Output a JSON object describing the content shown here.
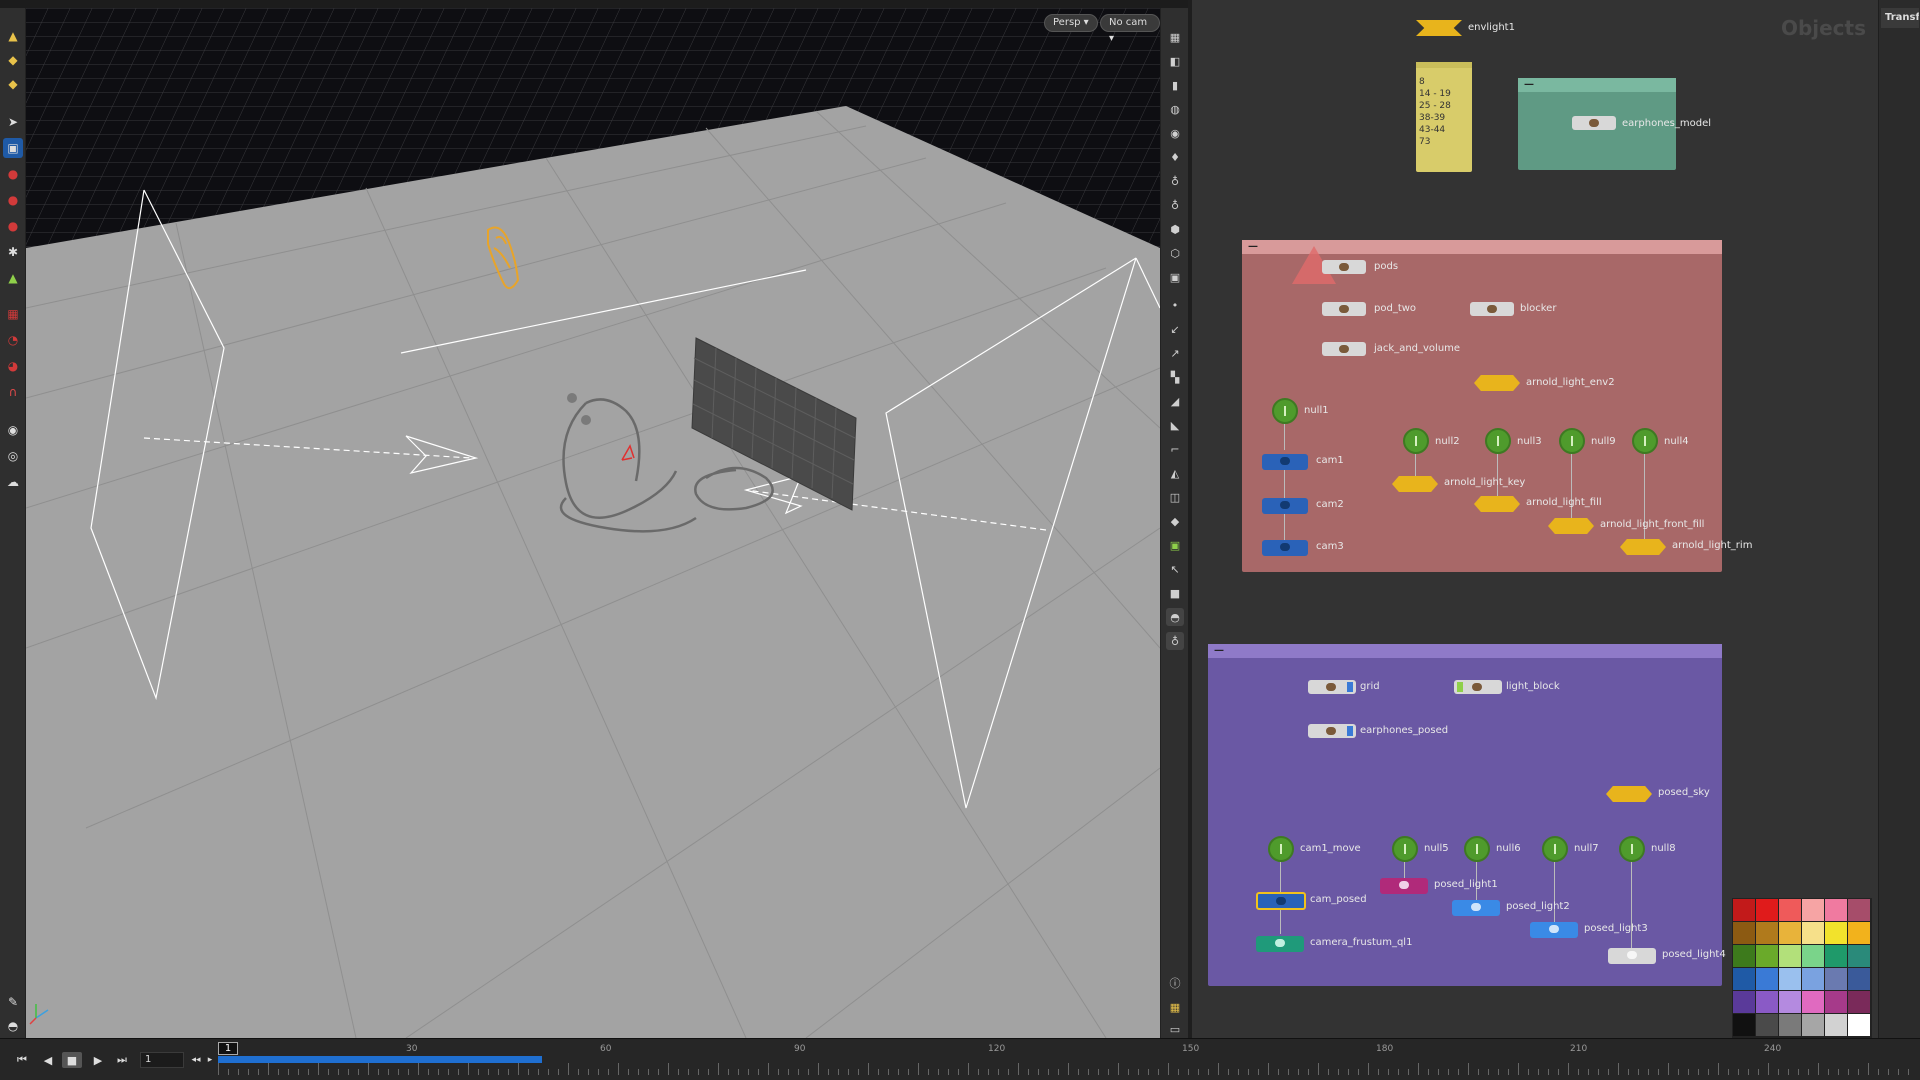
{
  "viewport": {
    "view_menu": "Persp ▾",
    "camera_menu": "No cam ▾"
  },
  "network": {
    "title": "Objects",
    "top_nodes": {
      "envlight": "envlight1",
      "sticky_note_lines": [
        "8",
        "14 - 19",
        "25 - 28",
        "38-39",
        "43-44",
        "73"
      ],
      "earphones_model": "earphones_model"
    },
    "red_box": {
      "pods": "pods",
      "pod_two": "pod_two",
      "blocker": "blocker",
      "jack_and_volume": "jack_and_volume",
      "arnold_light_env2": "arnold_light_env2",
      "null1": "null1",
      "null2": "null2",
      "null3": "null3",
      "null9": "null9",
      "null4": "null4",
      "cam1": "cam1",
      "cam2": "cam2",
      "cam3": "cam3",
      "arnold_light_key": "arnold_light_key",
      "arnold_light_fill": "arnold_light_fill",
      "arnold_light_front_fill": "arnold_light_front_fill",
      "arnold_light_rim": "arnold_light_rim"
    },
    "purple_box": {
      "grid": "grid",
      "light_block": "light_block",
      "earphones_posed": "earphones_posed",
      "posed_sky": "posed_sky",
      "cam1_move": "cam1_move",
      "null5": "null5",
      "null6": "null6",
      "null7": "null7",
      "null8": "null8",
      "posed_light1": "posed_light1",
      "cam_posed": "cam_posed",
      "posed_light2": "posed_light2",
      "posed_light3": "posed_light3",
      "camera_frustum_ql1": "camera_frustum_ql1",
      "posed_light4": "posed_light4"
    }
  },
  "side_tab": "Transf",
  "palette": [
    "#c21a1a",
    "#e01b1b",
    "#ef5a5a",
    "#f6a4a4",
    "#f07aa0",
    "#a64d6a",
    "#8c5a12",
    "#b07a1c",
    "#e8b33a",
    "#f6e08a",
    "#f2e22c",
    "#f2b21c",
    "#3d7a1c",
    "#6aaa2a",
    "#b2e07a",
    "#7ad48a",
    "#1f9a6a",
    "#2a8a7a",
    "#1f5aa6",
    "#3a7ad6",
    "#9ac0ee",
    "#7aa2e0",
    "#6a7ab0",
    "#3a5a9a",
    "#5a3a9a",
    "#8a5ac6",
    "#b48ae0",
    "#e06ac0",
    "#a63a8a",
    "#7a2a5a",
    "#111111",
    "#4a4a4a",
    "#7a7a7a",
    "#a6a6a6",
    "#d2d2d2",
    "#ffffff"
  ],
  "timeline": {
    "current_frame": "1",
    "frame_field": "1",
    "ticks": [
      "30",
      "60",
      "90",
      "120",
      "150",
      "180",
      "210",
      "240"
    ],
    "playback_range_fraction": 0.19
  }
}
